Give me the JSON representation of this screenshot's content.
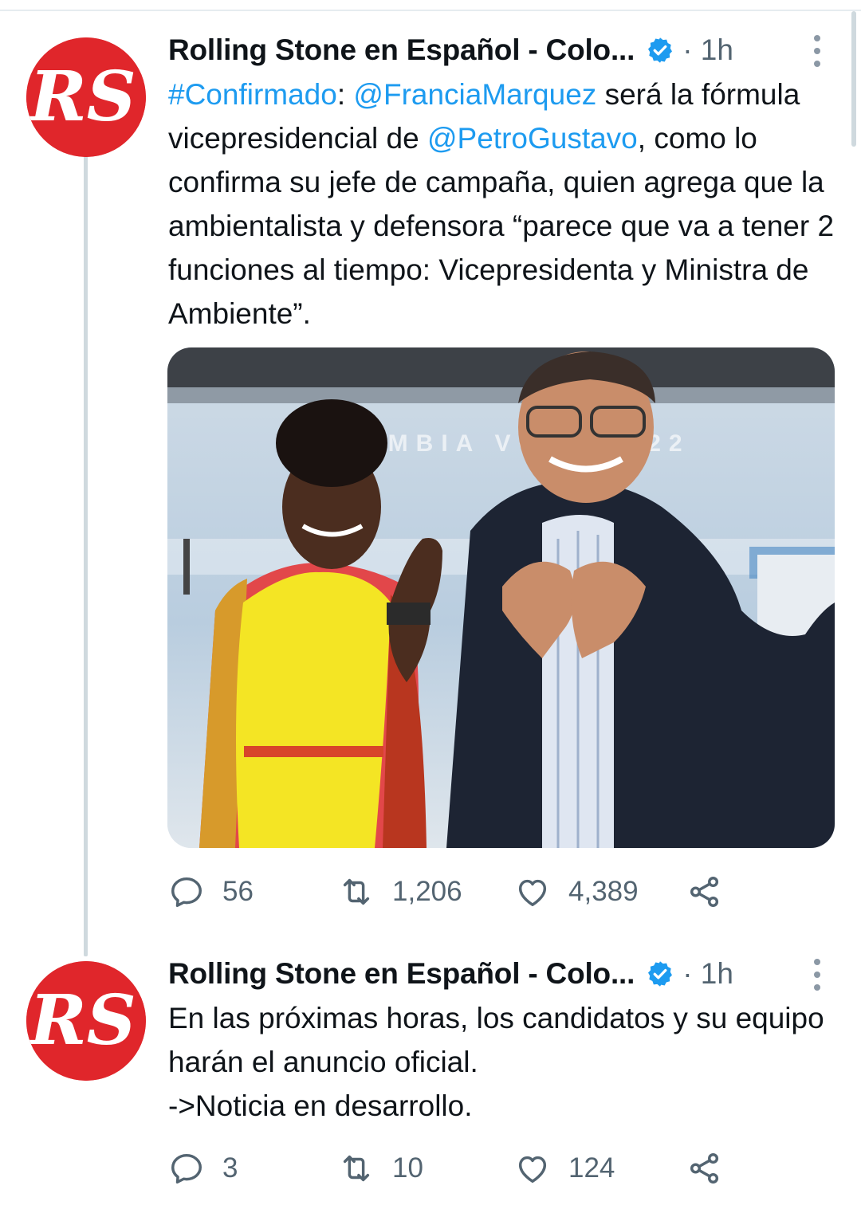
{
  "tweets": [
    {
      "author": "Rolling Stone en Español - Colo...",
      "time": "· 1h",
      "avatar_text": "RS",
      "text_parts": [
        {
          "t": "#Confirmado",
          "link": true
        },
        {
          "t": ": ",
          "link": false
        },
        {
          "t": "@FranciaMarquez",
          "link": true
        },
        {
          "t": " será la fórmula vicepresidencial de ",
          "link": false
        },
        {
          "t": "@PetroGustavo",
          "link": true
        },
        {
          "t": ", como lo confirma su jefe de campaña, quien agrega que la ambientalista y defensora “parece que va a tener 2 funciones al tiempo: Vicepresidenta y Ministra de Ambiente”.",
          "link": false
        }
      ],
      "media_backdrop_text": "COLOMBIA VOTA 2022",
      "replies": "56",
      "retweets": "1,206",
      "likes": "4,389"
    },
    {
      "author": "Rolling Stone en Español - Colo...",
      "time": "· 1h",
      "avatar_text": "RS",
      "text": "En las próximas horas, los candidatos y su equipo harán el anuncio oficial.\n->Noticia en desarrollo.",
      "replies": "3",
      "retweets": "10",
      "likes": "124"
    }
  ],
  "colors": {
    "link": "#1d9bf0",
    "secondary_text": "#536471",
    "brand_red": "#e0262b",
    "verified": "#1d9bf0"
  },
  "icons": [
    "reply-icon",
    "retweet-icon",
    "like-icon",
    "share-icon",
    "verified-badge-icon",
    "more-options-icon"
  ]
}
